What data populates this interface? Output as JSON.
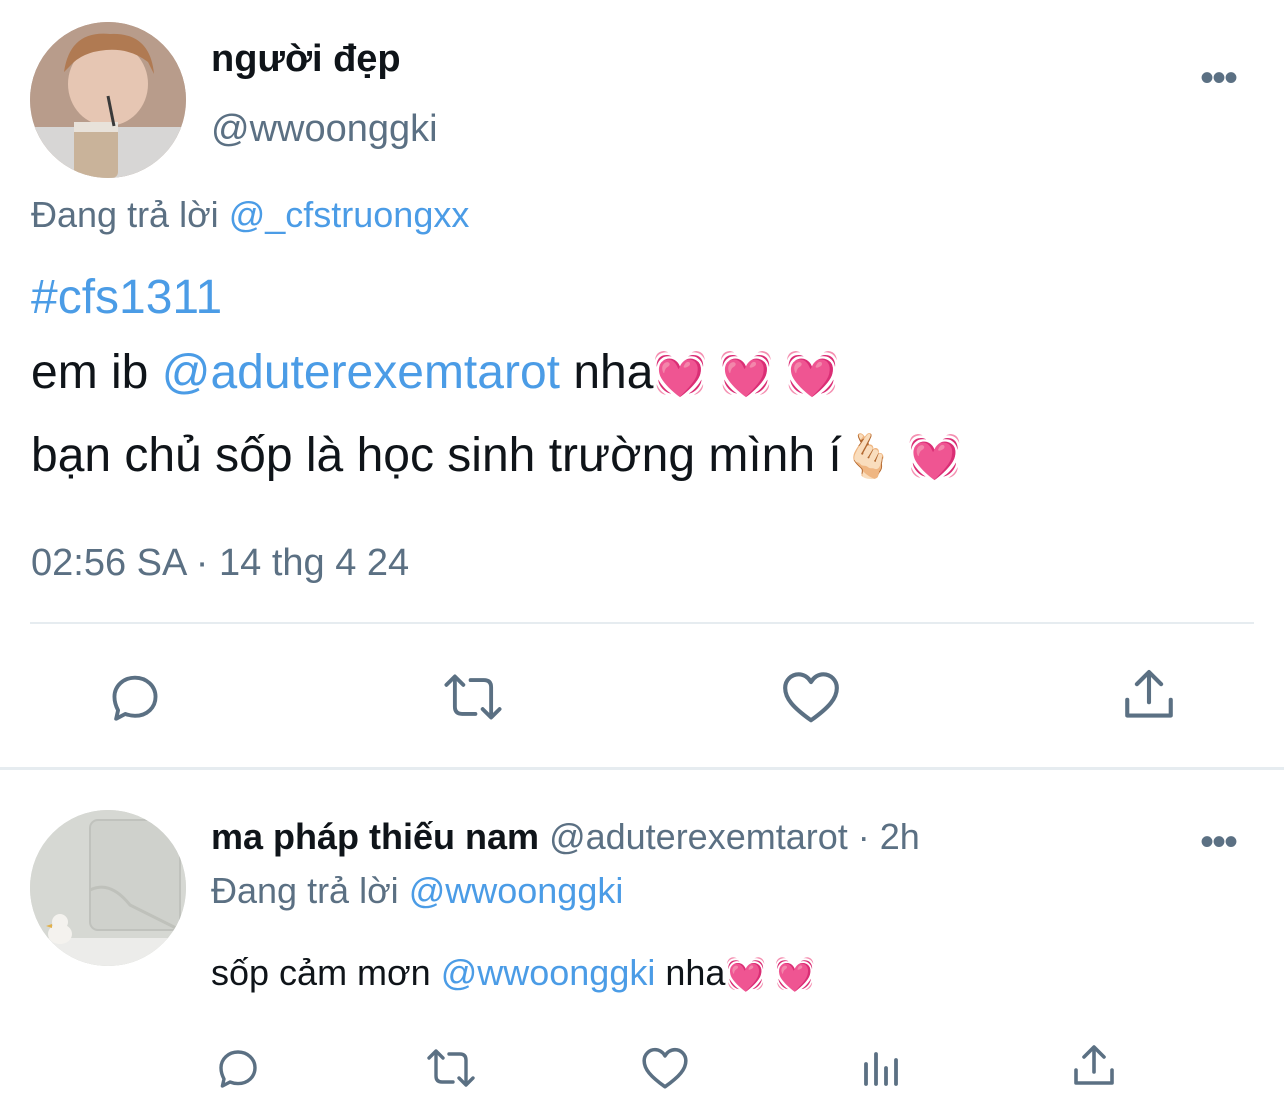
{
  "tweet": {
    "display_name": "người đẹp",
    "handle": "@wwoonggki",
    "replying_prefix": "Đang trả lời",
    "replying_to": "@_cfstruongxx",
    "hashtag": "#cfs1311",
    "line1_prefix": "em ib",
    "line1_mention": "@aduterexemtarot",
    "line1_suffix": "nha",
    "line1_emoji": "💓 💓 💓",
    "line2_text": "bạn chủ sốp là học sinh trường mình í",
    "line2_emoji": "🫰🏻 💓",
    "timestamp": "02:56 SA · 14 thg 4 24",
    "more": "•••"
  },
  "reply": {
    "display_name": "ma pháp thiếu nam",
    "handle": "@aduterexemtarot",
    "age": "· 2h",
    "replying_prefix": "Đang trả lời",
    "replying_to": "@wwoonggki",
    "text_prefix": "sốp cảm mơn",
    "text_mention": "@wwoonggki",
    "text_suffix": "nha",
    "text_emoji": "💓 💓",
    "more": "•••"
  },
  "colors": {
    "link": "#4b9ce6",
    "muted": "#5b7083",
    "text": "#0f1419",
    "divider": "#e6ecf0"
  },
  "icons": {
    "main_actions": [
      "reply-icon",
      "retweet-icon",
      "like-icon",
      "share-icon"
    ],
    "reply_actions": [
      "reply-icon",
      "retweet-icon",
      "like-icon",
      "analytics-icon",
      "share-icon"
    ]
  }
}
